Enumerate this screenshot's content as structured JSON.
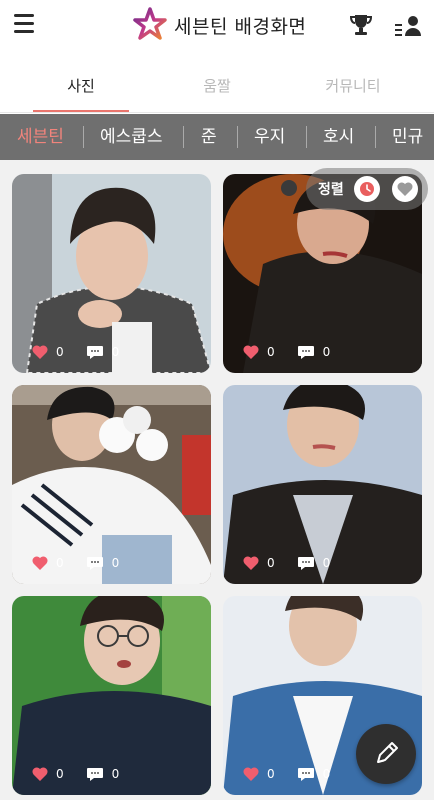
{
  "header": {
    "title": "세븐틴 배경화면",
    "logo_icon": "star-logo-icon",
    "menu_icon": "hamburger-menu-icon",
    "trophy_icon": "trophy-icon",
    "user_list_icon": "user-list-icon"
  },
  "tabs": [
    {
      "label": "사진",
      "active": true
    },
    {
      "label": "움짤",
      "active": false
    },
    {
      "label": "커뮤니티",
      "active": false
    }
  ],
  "categories": [
    "세븐틴",
    "에스쿱스",
    "준",
    "우지",
    "호시",
    "민규"
  ],
  "active_category": "세븐틴",
  "sort": {
    "label": "정렬",
    "options": [
      "clock-icon",
      "heart-icon"
    ]
  },
  "cards": [
    {
      "likes": "0",
      "comments": "0"
    },
    {
      "likes": "0",
      "comments": "0"
    },
    {
      "likes": "0",
      "comments": "0"
    },
    {
      "likes": "0",
      "comments": "0"
    },
    {
      "likes": "0",
      "comments": "0"
    },
    {
      "likes": "0",
      "comments": "0"
    }
  ],
  "fab_icon": "pencil-icon",
  "colors": {
    "accent": "#e9756d",
    "category_bar": "#6f6f6f",
    "fab": "#2f2f2f"
  }
}
